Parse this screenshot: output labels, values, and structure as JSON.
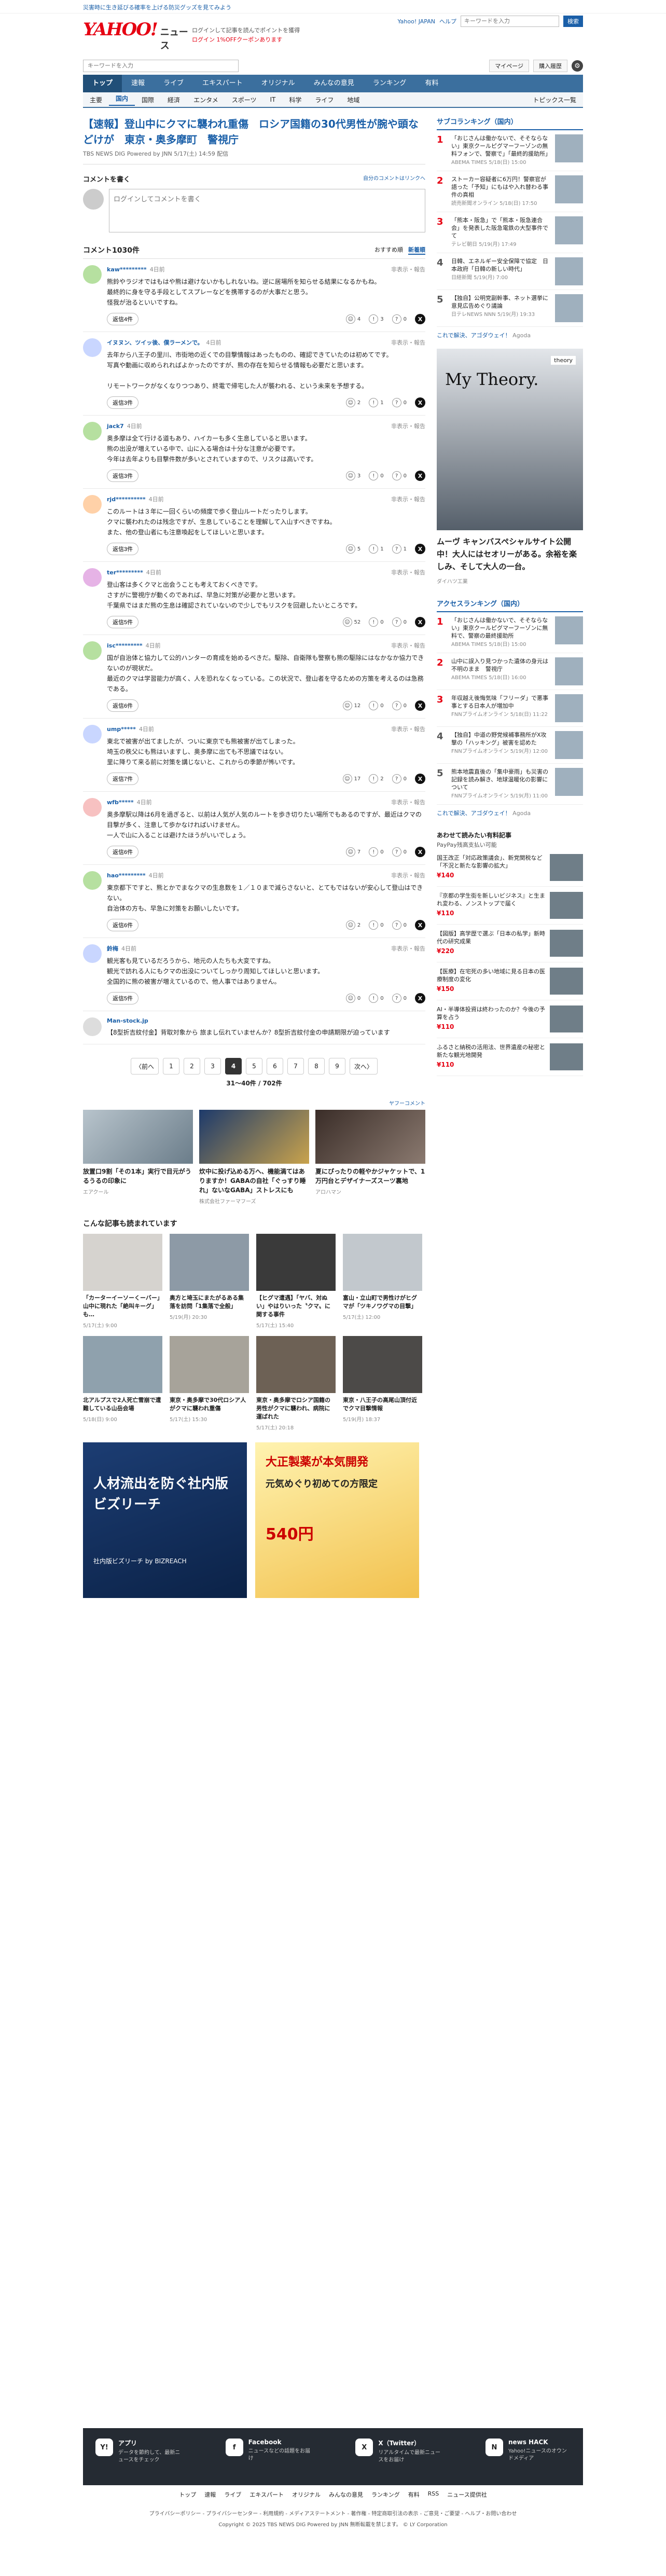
{
  "promo": "災害時に生き延びる確率を上げる防災グッズを見てみよう",
  "logo": {
    "main": "YAHOO!",
    "sub": "ニュース",
    "under": "JAPAN"
  },
  "header": {
    "line1": "ログインして記事を読んでポイントを獲得",
    "line2": "ログイン  1%OFFクーポンあります",
    "links": [
      "Yahoo! JAPAN",
      "ヘルプ"
    ],
    "search_placeholder": "キーワードを入力",
    "search_btn": "検索"
  },
  "searchrow": {
    "placeholder": "キーワードを入力",
    "mypage": "マイページ",
    "bought": "購入履歴"
  },
  "nav1": [
    "トップ",
    "速報",
    "ライブ",
    "エキスパート",
    "オリジナル",
    "みんなの意見",
    "ランキング",
    "有料"
  ],
  "nav2": [
    "主要",
    "国内",
    "国際",
    "経済",
    "エンタメ",
    "スポーツ",
    "IT",
    "科学",
    "ライフ",
    "地域"
  ],
  "nav2_right": "トピックス一覧",
  "article": {
    "title": "【速報】登山中にクマに襲われ重傷　ロシア国籍の30代男性が腕や頭などけが　東京・奥多摩町　警視庁",
    "meta": "TBS NEWS DIG Powered by JNN 5/17(土) 14:59 配信"
  },
  "comment_box": {
    "heading": "コメントを書く",
    "link": "自分のコメントはリンクへ",
    "placeholder": "ログインしてコメントを書く"
  },
  "comments_list": {
    "title": "コメント1030件",
    "sort_rec": "おすすめ順",
    "sort_new": "新着順"
  },
  "comments": [
    {
      "name": "kaw*********",
      "time": "4日前",
      "report": "非表示・報告",
      "text": "熊鈴やラジオではもはや熊は避けないかもしれないね。逆に居場所を知らせる結果になるかもね。\n最終的に身を守る手段としてスプレーなどを携帯するのが大事だと思う。\n怪我が治るといいですね。",
      "reply": "返信4件",
      "r1": "4",
      "r2": "3",
      "r3": "0"
    },
    {
      "name": "イヌヌン、ツイッ後、僕ラーメンで。",
      "time": "4日前",
      "report": "非表示・報告",
      "text": "去年から八王子の里川、市街地の近くでの目撃情報はあったものの、確認できていたのは初めてです。\n写真や動画に収められればよかったのですが、熊の存在を知らせる情報も必要だと思います。\n\nリモートワークがなくなりつつあり、終電で帰宅した人が襲われる、という未来を予想する。",
      "reply": "返信3件",
      "r1": "2",
      "r2": "1",
      "r3": "0"
    },
    {
      "name": "jack7",
      "time": "4日前",
      "report": "非表示・報告",
      "text": "奥多摩は全て行ける道もあり、ハイカーも多く生息していると思います。\n熊の出没が増えている中で、山に入る場合は十分な注意が必要です。\n今年は去年よりも目撃件数が多いとされていますので、リスクは高いです。",
      "reply": "返信3件",
      "r1": "3",
      "r2": "0",
      "r3": "0"
    },
    {
      "name": "rjd**********",
      "time": "4日前",
      "report": "非表示・報告",
      "text": "このルートは３年に一回くらいの頻度で歩く登山ルートだったりします。\nクマに襲われたのは残念ですが、生息していることを理解して入山すべきですね。\nまた、他の登山者にも注意喚起をしてほしいと思います。",
      "reply": "返信3件",
      "r1": "5",
      "r2": "1",
      "r3": "1"
    },
    {
      "name": "ter*********",
      "time": "4日前",
      "report": "非表示・報告",
      "text": "登山客は多くクマと出会うことも考えておくべきです。\nさすがに警視庁が動くのであれば、早急に対策が必要かと思います。\n千葉県ではまだ熊の生息は確認されていないので少しでもリスクを回避したいところです。",
      "reply": "返信5件",
      "r1": "52",
      "r2": "0",
      "r3": "0"
    },
    {
      "name": "isc*********",
      "time": "4日前",
      "report": "非表示・報告",
      "text": "国が自治体と協力して公的ハンターの育成を始めるべきだ。駆除、自衛隊も警察も熊の駆除にはなかなか協力できないのが現状だ。\n最近のクマは学習能力が高く、人を恐れなくなっている。この状況で、登山者を守るための方策を考えるのは急務である。",
      "reply": "返信6件",
      "r1": "12",
      "r2": "0",
      "r3": "0"
    },
    {
      "name": "ump*****",
      "time": "4日前",
      "report": "非表示・報告",
      "text": "東北で被害が出てましたが、ついに東京でも熊被害が出てしまった。\n埼玉の秩父にも熊はいますし、奥多摩に出ても不思議ではない。\n里に降りて来る前に対策を講じないと、これからの季節が怖いです。",
      "reply": "返信7件",
      "r1": "17",
      "r2": "2",
      "r3": "0"
    },
    {
      "name": "wfb*****",
      "time": "4日前",
      "report": "非表示・報告",
      "text": "奥多摩駅以降は6月を過ぎると、以前は人気が人気のルートを歩き切りたい場所でもあるのですが、最近はクマの目撃が多く、注意して歩かなければいけません。\n一人で山に入ることは避けたほうがいいでしょう。",
      "reply": "返信6件",
      "r1": "7",
      "r2": "0",
      "r3": "0"
    },
    {
      "name": "hao*********",
      "time": "4日前",
      "report": "非表示・報告",
      "text": "東京都下ですと、熊とかでまなクマの生息数を１／１０まで減らさないと、とてもではないが安心して登山はできない。\n自治体の方も、早急に対策をお願いしたいです。",
      "reply": "返信6件",
      "r1": "2",
      "r2": "0",
      "r3": "0"
    },
    {
      "name": "鈴梅",
      "time": "4日前",
      "report": "非表示・報告",
      "text": "観光客も見ているだろうから、地元の人たちも大変ですね。\n観光で訪れる人にもクマの出没についてしっかり周知してほしいと思います。\n全国的に熊の被害が増えているので、他人事ではありません。",
      "reply": "返信5件",
      "r1": "0",
      "r2": "0",
      "r3": "0"
    }
  ],
  "promo_comment": {
    "name": "Man-stock.jp",
    "text": "【8型折吉紋付金】背取対象から 旅まし伝れていませんか？8型折吉紋付金の申請期限が迫っています"
  },
  "pagination": {
    "prev": "〈前へ",
    "pages": [
      "1",
      "2",
      "3",
      "4",
      "5",
      "6",
      "7",
      "8",
      "9"
    ],
    "current": "4",
    "next": "次へ〉",
    "summary": "31〜40件 / 702件"
  },
  "ads_header": "ヤフーコメント",
  "ads3": [
    {
      "text": "放置口9割「その1本」実行で目元がうるうるの印象に",
      "src": "エアクール"
    },
    {
      "text": "炊中に投げ込める万へ、機能満てはありますか！GABAの自社「ぐっすり睡れ」ないなGABA」ストレスにも",
      "src": "株式会社ファーマフーズ"
    },
    {
      "text": "夏にぴったりの軽やかジャケットで、1万円台とデザイナーズスーツ裏地",
      "src": "アロハマン"
    }
  ],
  "related": {
    "title": "こんな記事も読まれています"
  },
  "grid": [
    {
      "t": "「カーターイーソーくーバー」山中に現れた「絶叫キーグ」も…",
      "s": "5/17(土) 9:00"
    },
    {
      "t": "奥方と埼玉にまたがるある集落を訪問「1集落で全般」",
      "s": "5/19(月) 20:30"
    },
    {
      "t": "【ヒグマ遭遇】「ヤバ、対ぬい」やはりいった〝クマ〟に関する事件",
      "s": "5/17(土) 15:40"
    },
    {
      "t": "富山・立山町で男性けがヒグマが「ツキノワグマの目撃」",
      "s": "5/17(土) 12:00"
    },
    {
      "t": "北アルプスで2人死亡雪崩で遭難している山岳会場",
      "s": "5/18(日) 9:00"
    },
    {
      "t": "東京・奥多摩で30代ロシア人がクマに襲われ重傷",
      "s": "5/17(土) 15:30"
    },
    {
      "t": "東京・奥多摩でロシア国籍の男性がクマに襲われ、病院に運ばれた",
      "s": "5/17(土) 20:18"
    },
    {
      "t": "東京・八王子の高尾山頂付近でクマ目撃情報",
      "s": "5/19(月) 18:37"
    }
  ],
  "banner1": {
    "l1": "人材流出を防ぐ社内版ビズリーチ",
    "l2": "社内版ビズリーチ by BIZREACH"
  },
  "banner2": {
    "l1": "大正製薬が本気開発",
    "l2": "元気めぐり初めての方限定",
    "l3": "540円"
  },
  "side_rank": {
    "title": "サブコランキング（国内）",
    "items": [
      {
        "no": "1",
        "t": "「おじさんは働かないで、そそならない」東京クールピグマーフーゾンの無料フォンで、警察で」「最終的援助所」",
        "m": "ABEMA TIMES 5/18(日) 15:00"
      },
      {
        "t": "ストーカー容疑者に6万円！警察官が語った「予知」にもはや入れ替わる事件の真相",
        "m": "読売新聞オンライン 5/18(日) 17:50",
        "no": "2"
      },
      {
        "no": "3",
        "t": "「熊本・阪急」で「熊本・阪急連合会」を発表した阪急電鉄の大型事件でて",
        "m": "テレビ朝日 5/19(月) 17:49"
      },
      {
        "no": "4",
        "t": "日韓、エネルギー安全保障で協定　日本政府「日韓の新しい時代」",
        "m": "日経新聞 5/19(月) 7:00"
      },
      {
        "no": "5",
        "t": "【独自】公明党副幹事、ネット選挙に意見広告めぐり議論",
        "m": "日テレNEWS NNN 5/19(月) 19:33"
      }
    ],
    "pr": "これで解決、アゴダウェイ！",
    "pr_src": "Agoda"
  },
  "side_ad": {
    "brand": "My Theory.",
    "logo": "theory",
    "copy": "ムーヴ キャンバスペシャルサイト公開中！大人にはセオリーがある。余裕を楽しみ、そして大人の一台。",
    "src": "ダイハツ工業"
  },
  "side_rank2": {
    "title": "アクセスランキング（国内）",
    "items": [
      {
        "no": "1",
        "t": "「おじさんは働かないで、そそならない」東京クールピグマーフーゾンに無料で、警察の最終援助所",
        "m": "ABEMA TIMES 5/18(日) 15:00"
      },
      {
        "no": "2",
        "t": "山中に誤入り見つかった遺体の身元は不明のまま　警視庁",
        "m": "ABEMA TIMES 5/18(日) 16:00"
      },
      {
        "no": "3",
        "t": "年収越え後悔気味「フリーダ」で悪事事とする日本人が増加中",
        "m": "FNNプライムオンライン 5/18(日) 11:22"
      },
      {
        "no": "4",
        "t": "【独自】中道の野党候補事務所がX攻撃の「ハッキング」被害を認めた",
        "m": "FNNプライムオンライン 5/19(月) 12:00"
      },
      {
        "no": "5",
        "t": "熊本地震直後の「集中豪雨」も災害の記録を読み解き、地球温暖化の影響について",
        "m": "FNNプライムオンライン 5/19(月) 11:00"
      }
    ],
    "pr": "これで解決、アゴダウェイ！",
    "pr_src": "Agoda"
  },
  "paypay": {
    "title": "あわせて読みたい有料記事",
    "sub": "PayPay残高支払い可能",
    "items": [
      {
        "t": "国王改正「対応政策議会」、新党関税など「不況と新たな影響の拡大」",
        "p": "¥140"
      },
      {
        "t": "『京都の学生街を新しいビジネス』と生まれ変わる、ノンストップで届く",
        "p": "¥110"
      },
      {
        "t": "【図版】高学歴で選ぶ「日本の私学」新時代の研究成果",
        "p": "¥220"
      },
      {
        "t": "【医療】在宅死の多い地域に見る日本の医療制度の変化",
        "p": "¥150"
      },
      {
        "t": "AI・半導体投資は終わったのか？今後の予算を占う",
        "p": "¥110"
      },
      {
        "t": "ふるさと納税の活用法、世界遺産の秘密と新たな観光地開発",
        "p": "¥110"
      }
    ]
  },
  "footer": {
    "apps": [
      {
        "ic": "Y!",
        "t": "アプリ",
        "d": "データを節約して、最新ニュースをチェック"
      },
      {
        "ic": "f",
        "t": "Facebook",
        "d": "ニュースなどの話題をお届け"
      },
      {
        "ic": "X",
        "t": "X（Twitter）",
        "d": "リアルタイムで最新ニュースをお届け"
      },
      {
        "ic": "N",
        "t": "news HACK",
        "d": "Yahoo!ニュースのオウンドメディア"
      }
    ],
    "links": [
      "トップ",
      "速報",
      "ライブ",
      "エキスパート",
      "オリジナル",
      "みんなの意見",
      "ランキング",
      "有料",
      "RSS",
      "ニュース提供社"
    ],
    "small": "プライバシーポリシー - プライバシーセンター - 利用規約 - メディアステートメント - 著作権 - 特定商取引法の表示 - ご意見・ご要望 - ヘルプ・お問い合わせ",
    "copy": "Copyright © 2025 TBS NEWS DIG Powered by JNN 無断転載を禁じます。 © LY Corporation"
  }
}
